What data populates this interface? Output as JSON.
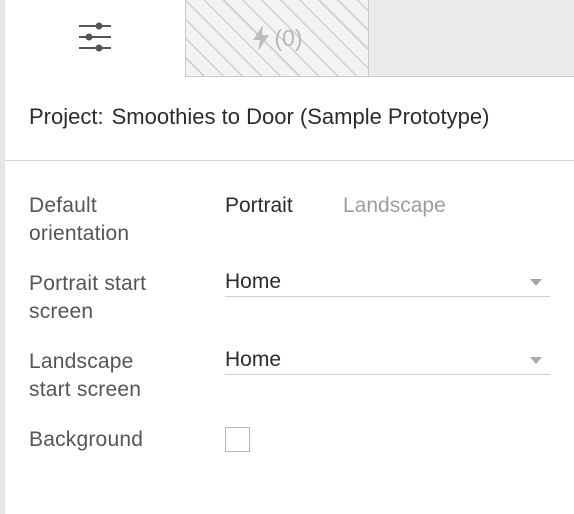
{
  "tabs": {
    "settings_icon": "sliders-icon",
    "interactions_icon": "bolt-icon",
    "interactions_count": "(0)"
  },
  "project": {
    "label": "Project:",
    "name": "Smoothies to Door (Sample Prototype)"
  },
  "settings": {
    "default_orientation": {
      "label": "Default orientation",
      "options": [
        "Portrait",
        "Landscape"
      ],
      "selected": "Portrait"
    },
    "portrait_start_screen": {
      "label": "Portrait start screen",
      "value": "Home"
    },
    "landscape_start_screen": {
      "label": "Landscape start screen",
      "value": "Home"
    },
    "background": {
      "label": "Background",
      "checked": false
    }
  },
  "colors": {
    "text": "#2b2b2b",
    "label": "#555555",
    "inactive": "#9a9ea3",
    "border": "#c9c9c9"
  }
}
